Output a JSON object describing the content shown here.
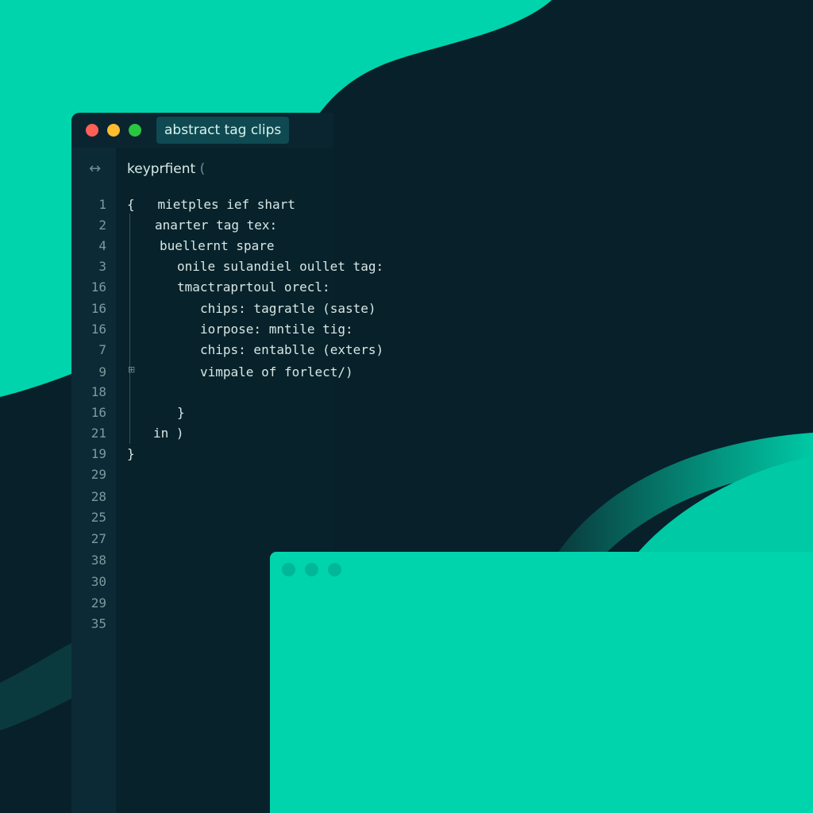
{
  "colors": {
    "background": "#08202a",
    "accent": "#00d4ad",
    "traffic_red": "#ff5f57",
    "traffic_yellow": "#febc2e",
    "traffic_green": "#28c840"
  },
  "editor": {
    "tab_title": "abstract tag clips",
    "file_label": "keyprfient",
    "file_bracket": "(",
    "expand_icon": "↔",
    "lines": [
      {
        "num": "1",
        "text": "{   mietples ief shart"
      },
      {
        "num": "2",
        "text": "anarter tag tex:"
      },
      {
        "num": "4",
        "text": "buellernt spare"
      },
      {
        "num": "3",
        "text": "onile sulandiel oullet tag:"
      },
      {
        "num": "16",
        "text": "tmactraprtoul orecl:"
      },
      {
        "num": "16",
        "text": "chips: tagratle (saste)"
      },
      {
        "num": "16",
        "text": "iorpose: mntile tig:"
      },
      {
        "num": "7",
        "text": "chips: entablle (exters)"
      },
      {
        "num": "9",
        "text": "vimpale of forlect/)"
      },
      {
        "num": "18",
        "text": ""
      },
      {
        "num": "16",
        "text": "}"
      },
      {
        "num": "21",
        "text": "in )"
      },
      {
        "num": "19",
        "text": "}"
      },
      {
        "num": "29",
        "text": ""
      },
      {
        "num": "28",
        "text": ""
      },
      {
        "num": "25",
        "text": ""
      },
      {
        "num": "27",
        "text": ""
      },
      {
        "num": "38",
        "text": ""
      },
      {
        "num": "30",
        "text": ""
      },
      {
        "num": "29",
        "text": ""
      },
      {
        "num": "35",
        "text": ""
      }
    ]
  }
}
